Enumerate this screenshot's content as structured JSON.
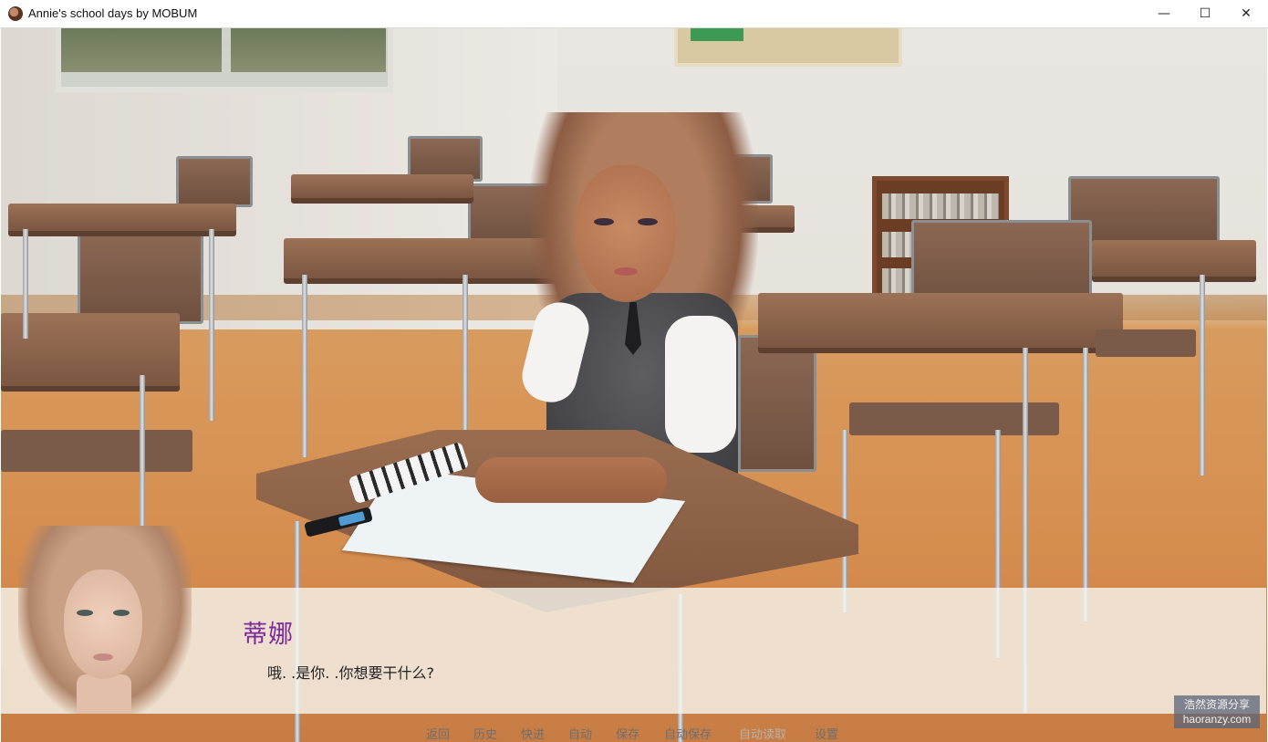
{
  "window": {
    "title": "Annie's school days by MOBUM",
    "minimize_glyph": "—",
    "maximize_glyph": "☐",
    "close_glyph": "✕"
  },
  "dialogue": {
    "speaker": "蒂娜",
    "speaker_color": "#7a2a9a",
    "text": "哦. .是你. .你想要干什么?"
  },
  "quick_menu": [
    "返回",
    "历史",
    "快进",
    "自动",
    "保存",
    "自动保存",
    "自动读取",
    "设置"
  ],
  "watermark": {
    "line1": "浩然资源分享",
    "line2": "haoranzy.com"
  }
}
